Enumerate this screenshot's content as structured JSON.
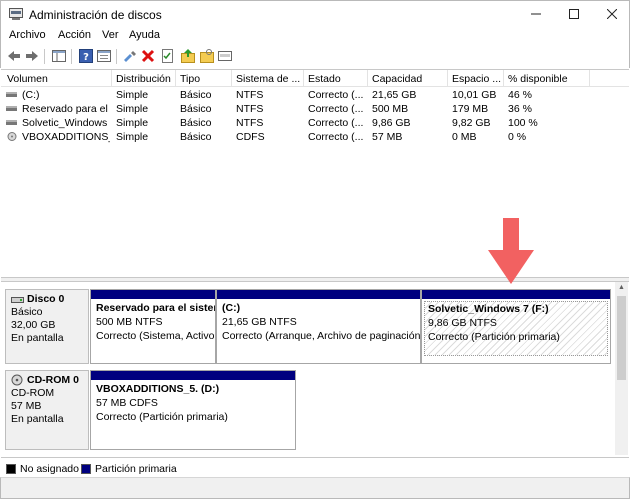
{
  "window": {
    "title": "Administración de discos"
  },
  "menu": [
    "Archivo",
    "Acción",
    "Ver",
    "Ayuda"
  ],
  "volumes": {
    "columns": [
      "Volumen",
      "Distribución",
      "Tipo",
      "Sistema de ...",
      "Estado",
      "Capacidad",
      "Espacio ...",
      "% disponible"
    ],
    "rows": [
      [
        "(C:)",
        "Simple",
        "Básico",
        "NTFS",
        "Correcto (...",
        "21,65 GB",
        "10,01 GB",
        "46 %"
      ],
      [
        "Reservado para el ...",
        "Simple",
        "Básico",
        "NTFS",
        "Correcto (...",
        "500 MB",
        "179 MB",
        "36 %"
      ],
      [
        "Solvetic_Windows ...",
        "Simple",
        "Básico",
        "NTFS",
        "Correcto (...",
        "9,86 GB",
        "9,82 GB",
        "100 %"
      ],
      [
        "VBOXADDITIONS_...",
        "Simple",
        "Básico",
        "CDFS",
        "Correcto (...",
        "57 MB",
        "0 MB",
        "0 %"
      ]
    ]
  },
  "disks": [
    {
      "name": "Disco 0",
      "type": "Básico",
      "size": "32,00 GB",
      "status": "En pantalla",
      "partitions": [
        {
          "name": "Reservado para el sistem",
          "size": "500 MB NTFS",
          "status": "Correcto (Sistema, Activo,"
        },
        {
          "name": "(C:)",
          "size": "21,65 GB NTFS",
          "status": "Correcto (Arranque, Archivo de paginación,"
        },
        {
          "name": "Solvetic_Windows 7  (F:)",
          "size": "9,86 GB NTFS",
          "status": "Correcto (Partición primaria)"
        }
      ]
    },
    {
      "name": "CD-ROM 0",
      "type": "CD-ROM",
      "size": "57 MB",
      "status": "En pantalla",
      "partitions": [
        {
          "name": "VBOXADDITIONS_5.  (D:)",
          "size": "57 MB CDFS",
          "status": "Correcto (Partición primaria)"
        }
      ]
    }
  ],
  "legend": [
    {
      "label": "No asignado",
      "color": "#000000"
    },
    {
      "label": "Partición primaria",
      "color": "#00007f"
    }
  ],
  "colors": {
    "partition_bar": "#00007f",
    "arrow": "#f26161"
  }
}
